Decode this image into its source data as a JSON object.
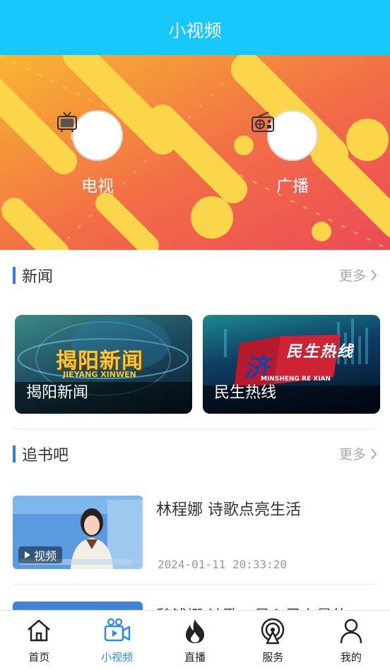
{
  "header": {
    "title": "小视频"
  },
  "banner": {
    "buttons": [
      {
        "label": "电视",
        "icon": "tv-icon"
      },
      {
        "label": "广播",
        "icon": "radio-icon"
      }
    ]
  },
  "news": {
    "title": "新闻",
    "more": "更多",
    "cards": [
      {
        "caption": "揭阳新闻",
        "logo_text": "揭阳新闻",
        "logo_sub": "JIEYANG XINWEN"
      },
      {
        "caption": "民生热线",
        "logo_text": "民生热线",
        "logo_sub": "MINSHENG RE XIAN"
      }
    ]
  },
  "books": {
    "title": "追书吧",
    "more": "更多",
    "items": [
      {
        "title": "林程娜  诗歌点亮生活",
        "date": "2024-01-11  20:33:20",
        "tag": "视频"
      },
      {
        "title": "魏钱娜  诗歌、是心灵上最的"
      }
    ]
  },
  "tabbar": {
    "items": [
      {
        "label": "首页",
        "icon": "home-icon"
      },
      {
        "label": "小视频",
        "icon": "video-camera-icon"
      },
      {
        "label": "直播",
        "icon": "flame-icon"
      },
      {
        "label": "服务",
        "icon": "broadcast-icon"
      },
      {
        "label": "我的",
        "icon": "user-icon"
      }
    ]
  },
  "colors": {
    "header": "#17c8ff",
    "accent": "#2a8ae6",
    "section_bar": "#2a7fe0"
  }
}
